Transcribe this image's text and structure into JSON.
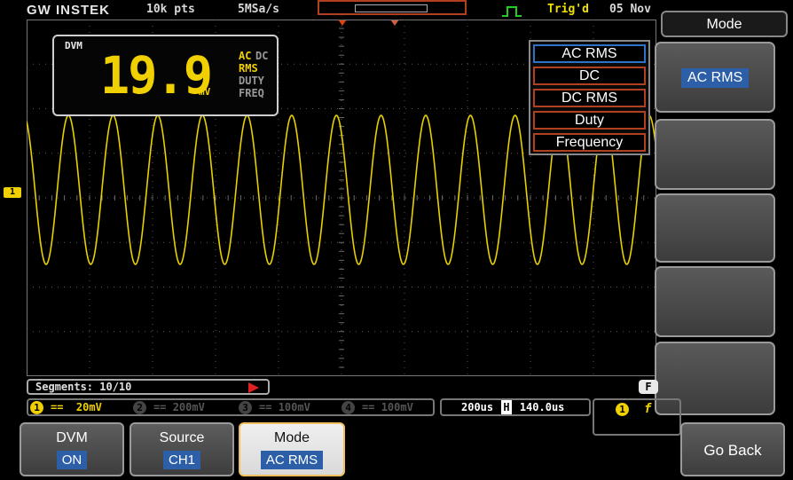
{
  "topbar": {
    "brand": "GW INSTEK",
    "points": "10k pts",
    "sample_rate": "5MSa/s",
    "trig_status": "Trig'd",
    "date": "05 Nov"
  },
  "dvm_panel": {
    "label": "DVM",
    "value": "19.9",
    "unit": "mV",
    "coupling_ac": "AC",
    "coupling_dc": "DC",
    "modes": [
      "RMS",
      "DUTY",
      "FREQ"
    ]
  },
  "mode_dropdown": {
    "items": [
      "AC RMS",
      "DC",
      "DC RMS",
      "Duty",
      "Frequency"
    ],
    "selected": "AC RMS"
  },
  "side_menu": {
    "title": "Mode",
    "mode_value": "AC RMS"
  },
  "channel_marker": "1",
  "segments": {
    "label": "Segments: 10/10"
  },
  "f_badge": "F",
  "status_line": {
    "ch1": {
      "num": "1",
      "coupling": "==",
      "scale": "20mV",
      "color": "#f0d000"
    },
    "ch2": {
      "num": "2",
      "coupling": "==",
      "scale": "200mV",
      "color": "#555555"
    },
    "ch3": {
      "num": "3",
      "coupling": "==",
      "scale": "100mV",
      "color": "#555555"
    },
    "ch4": {
      "num": "4",
      "coupling": "==",
      "scale": "100mV",
      "color": "#555555"
    }
  },
  "timebase": {
    "scale": "200us",
    "h_icon": "H",
    "position": "140.0us"
  },
  "trigger": {
    "channel": "1",
    "slope": "f"
  },
  "bottom_menu": {
    "dvm": {
      "label": "DVM",
      "value": "ON"
    },
    "source": {
      "label": "Source",
      "value": "CH1"
    },
    "mode": {
      "label": "Mode",
      "value": "AC RMS"
    },
    "go_back": {
      "label": "Go Back"
    }
  },
  "waveform": {
    "color": "#e8d000",
    "cycles": 14.1
  }
}
